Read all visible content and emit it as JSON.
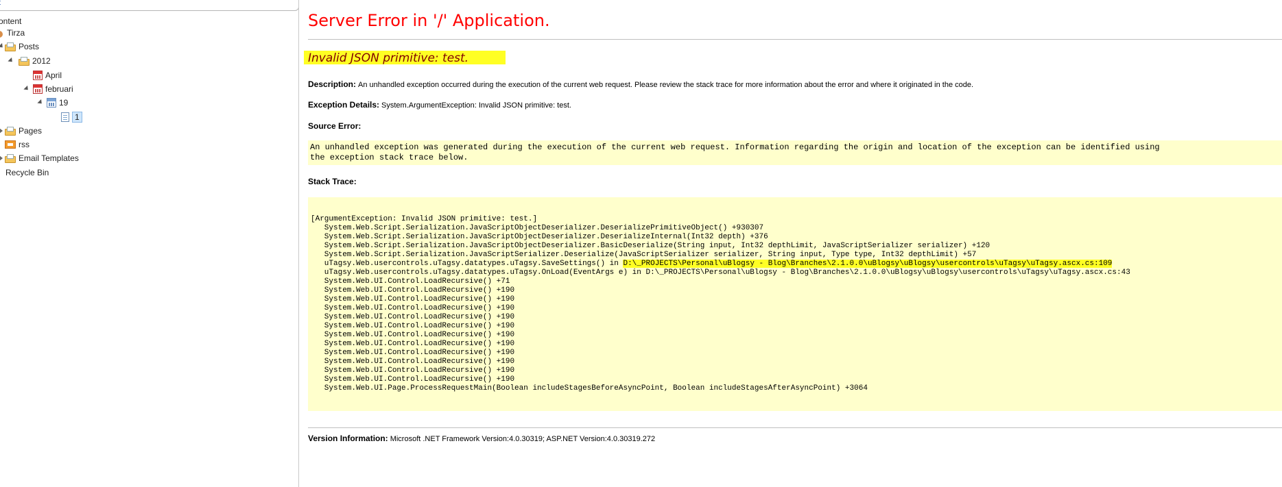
{
  "tree": {
    "header_link": "t",
    "nodes": [
      {
        "id": "content",
        "label": "ontent"
      },
      {
        "id": "tirza",
        "label": "Tirza"
      },
      {
        "id": "posts",
        "label": "Posts"
      },
      {
        "id": "year-2012",
        "label": "2012"
      },
      {
        "id": "april",
        "label": "April"
      },
      {
        "id": "februari",
        "label": "februari"
      },
      {
        "id": "day-19",
        "label": "19"
      },
      {
        "id": "post-1",
        "label": "1"
      },
      {
        "id": "pages",
        "label": "Pages"
      },
      {
        "id": "rss",
        "label": "rss"
      },
      {
        "id": "email-templates",
        "label": "Email Templates"
      },
      {
        "id": "recycle-bin",
        "label": "Recycle Bin"
      }
    ]
  },
  "error": {
    "title": "Server Error in '/' Application.",
    "message": "Invalid JSON primitive: test.",
    "description_label": "Description:",
    "description_text": "An unhandled exception occurred during the execution of the current web request. Please review the stack trace for more information about the error and where it originated in the code.",
    "exception_label": "Exception Details:",
    "exception_text": "System.ArgumentException: Invalid JSON primitive: test.",
    "source_error_label": "Source Error:",
    "source_error_line1": "An unhandled exception was generated during the execution of the current web request. Information regarding the origin and location of the exception can be identified using",
    "source_error_line2": "the exception stack trace below.",
    "stack_trace_label": "Stack Trace:",
    "stack_trace": [
      "[ArgumentException: Invalid JSON primitive: test.]",
      "   System.Web.Script.Serialization.JavaScriptObjectDeserializer.DeserializePrimitiveObject() +930307",
      "   System.Web.Script.Serialization.JavaScriptObjectDeserializer.DeserializeInternal(Int32 depth) +376",
      "   System.Web.Script.Serialization.JavaScriptObjectDeserializer.BasicDeserialize(String input, Int32 depthLimit, JavaScriptSerializer serializer) +120",
      "   System.Web.Script.Serialization.JavaScriptSerializer.Deserialize(JavaScriptSerializer serializer, String input, Type type, Int32 depthLimit) +57",
      "   uTagsy.Web.usercontrols.uTagsy.datatypes.uTagsy.SaveSettings() in ",
      "   uTagsy.Web.usercontrols.uTagsy.datatypes.uTagsy.OnLoad(EventArgs e) in D:\\_PROJECTS\\Personal\\uBlogsy - Blog\\Branches\\2.1.0.0\\uBlogsy\\uBlogsy\\usercontrols\\uTagsy\\uTagsy.ascx.cs:43",
      "   System.Web.UI.Control.LoadRecursive() +71",
      "   System.Web.UI.Control.LoadRecursive() +190",
      "   System.Web.UI.Control.LoadRecursive() +190",
      "   System.Web.UI.Control.LoadRecursive() +190",
      "   System.Web.UI.Control.LoadRecursive() +190",
      "   System.Web.UI.Control.LoadRecursive() +190",
      "   System.Web.UI.Control.LoadRecursive() +190",
      "   System.Web.UI.Control.LoadRecursive() +190",
      "   System.Web.UI.Control.LoadRecursive() +190",
      "   System.Web.UI.Control.LoadRecursive() +190",
      "   System.Web.UI.Control.LoadRecursive() +190",
      "   System.Web.UI.Control.LoadRecursive() +190",
      "   System.Web.UI.Page.ProcessRequestMain(Boolean includeStagesBeforeAsyncPoint, Boolean includeStagesAfterAsyncPoint) +3064"
    ],
    "highlighted_path": "D:\\_PROJECTS\\Personal\\uBlogsy - Blog\\Branches\\2.1.0.0\\uBlogsy\\uBlogsy\\usercontrols\\uTagsy\\uTagsy.ascx.cs:109",
    "version_label": "Version Information:",
    "version_text": "Microsoft .NET Framework Version:4.0.30319; ASP.NET Version:4.0.30319.272"
  },
  "colors": {
    "title_red": "#ff0000",
    "message_maroon": "#800000",
    "code_bg": "#ffffcc",
    "highlight": "#ffff24"
  }
}
